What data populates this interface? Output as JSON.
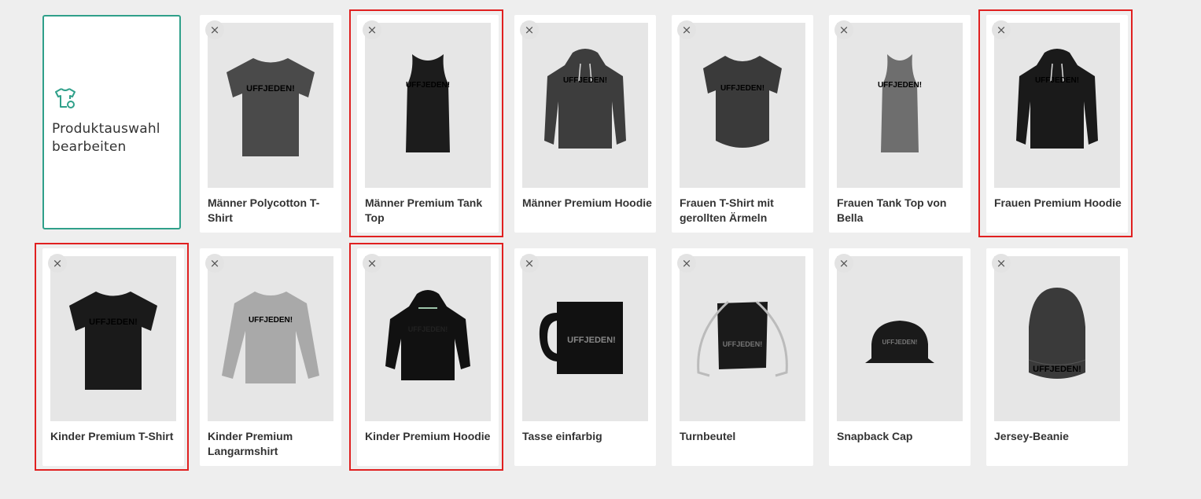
{
  "edit_card": {
    "label": "Produktauswahl bearbeiten",
    "icon": "shirt-settings-icon"
  },
  "colors": {
    "accent": "#2fa08a",
    "highlight": "#e02020",
    "background": "#eeeeee"
  },
  "print_text": "UFFJEDEN!",
  "close_symbol": "×",
  "products": [
    {
      "name": "Männer Polycotton T-Shirt",
      "type": "tshirt",
      "color": "#4a4a4a",
      "highlighted": false
    },
    {
      "name": "Männer Premium Tank Top",
      "type": "tank",
      "color": "#1c1c1c",
      "highlighted": true
    },
    {
      "name": "Männer Premium Hoodie",
      "type": "hoodie",
      "color": "#3d3d3d",
      "highlighted": false
    },
    {
      "name": "Frauen T-Shirt mit gerollten Ärmeln",
      "type": "womentee",
      "color": "#3a3a3a",
      "highlighted": false
    },
    {
      "name": "Frauen Tank Top von Bella",
      "type": "racer",
      "color": "#6e6e6e",
      "highlighted": false
    },
    {
      "name": "Frauen Premium Hoodie",
      "type": "hoodie",
      "color": "#1a1a1a",
      "highlighted": true
    },
    {
      "name": "Kinder Premium T-Shirt",
      "type": "tshirt",
      "color": "#1a1a1a",
      "highlighted": true
    },
    {
      "name": "Kinder Premium Langarmshirt",
      "type": "longsleeve",
      "color": "#a9a9a9",
      "highlighted": false
    },
    {
      "name": "Kinder Premium Hoodie",
      "type": "kidhoodie",
      "color": "#111111",
      "highlighted": true
    },
    {
      "name": "Tasse einfarbig",
      "type": "mug",
      "color": "#111111",
      "highlighted": false
    },
    {
      "name": "Turnbeutel",
      "type": "bag",
      "color": "#1a1a1a",
      "highlighted": false
    },
    {
      "name": "Snapback Cap",
      "type": "cap",
      "color": "#1a1a1a",
      "highlighted": false
    },
    {
      "name": "Jersey-Beanie",
      "type": "beanie",
      "color": "#3a3a3a",
      "highlighted": false
    }
  ]
}
